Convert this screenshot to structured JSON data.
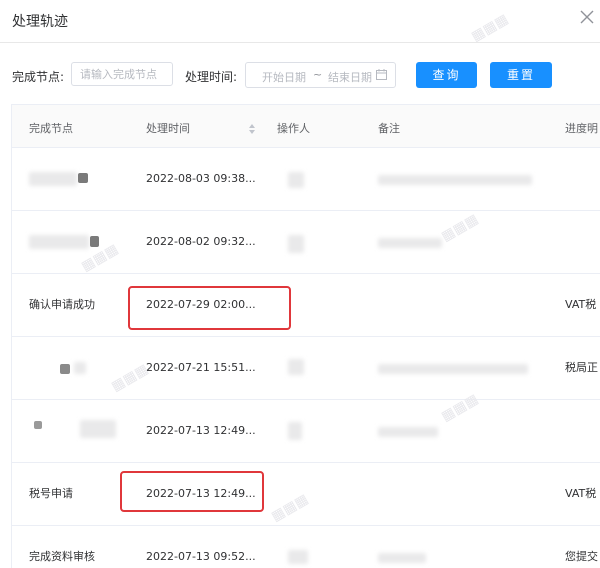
{
  "dialog": {
    "title": "处理轨迹"
  },
  "filters": {
    "node_label": "完成节点:",
    "node_placeholder": "请输入完成节点",
    "time_label": "处理时间:",
    "start_placeholder": "开始日期",
    "range_sep": "~",
    "end_placeholder": "结束日期",
    "query_button": "查询",
    "reset_button": "重置"
  },
  "table": {
    "columns": [
      "完成节点",
      "处理时间",
      "操作人",
      "备注",
      "进度明"
    ],
    "rows": [
      {
        "node": "",
        "time": "2022-08-03 09:38...",
        "operator": "",
        "remark": "",
        "progress": ""
      },
      {
        "node": "",
        "time": "2022-08-02 09:32...",
        "operator": "",
        "remark": "",
        "progress": ""
      },
      {
        "node": "确认申请成功",
        "time": "2022-07-29 02:00...",
        "operator": "",
        "remark": "",
        "progress": "VAT税"
      },
      {
        "node": "",
        "time": "2022-07-21 15:51...",
        "operator": "",
        "remark": "",
        "progress": "税局正"
      },
      {
        "node": "",
        "time": "2022-07-13 12:49...",
        "operator": "",
        "remark": "",
        "progress": ""
      },
      {
        "node": "税号申请",
        "time": "2022-07-13 12:49...",
        "operator": "",
        "remark": "",
        "progress": "VAT税"
      },
      {
        "node": "完成资料审核",
        "time": "2022-07-13 09:52...",
        "operator": "",
        "remark": "",
        "progress": "您提交"
      }
    ]
  },
  "icons": {
    "close": "close-icon",
    "calendar": "calendar-icon",
    "sort": "sort-caret-icon"
  },
  "colors": {
    "primary": "#1890ff",
    "highlight": "#e0373b"
  }
}
